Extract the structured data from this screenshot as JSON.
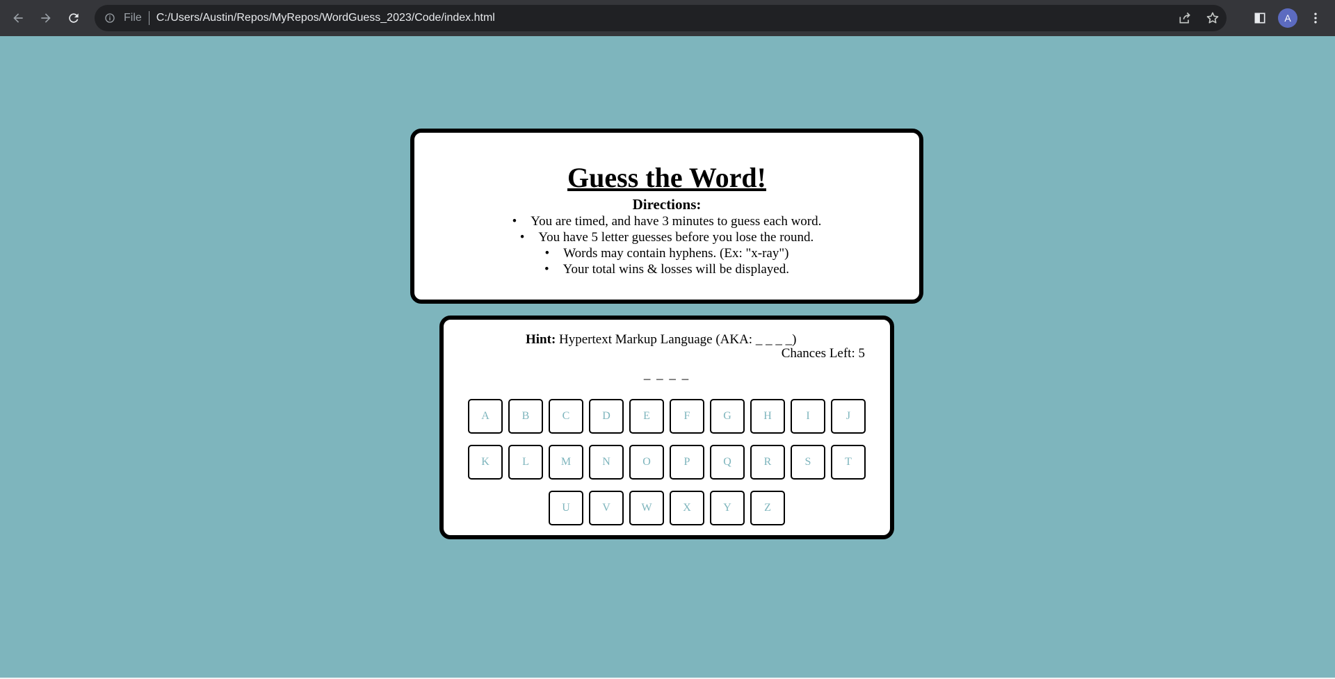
{
  "browser": {
    "scheme_label": "File",
    "url": "C:/Users/Austin/Repos/MyRepos/WordGuess_2023/Code/index.html",
    "avatar_letter": "A",
    "icons": [
      "back-arrow-icon",
      "forward-arrow-icon",
      "reload-icon",
      "info-icon",
      "share-icon",
      "star-icon",
      "side-panel-icon",
      "more-vert-icon"
    ]
  },
  "directions": {
    "title": "Guess the Word!",
    "subtitle": "Directions:",
    "rules": [
      "You are timed, and have 3 minutes to guess each word.",
      "You have 5 letter guesses before you lose the round.",
      "Words may contain hyphens. (Ex: \"x-ray\")",
      "Your total wins & losses will be displayed."
    ]
  },
  "game": {
    "hint_label": "Hint:",
    "hint_text": "Hypertext Markup Language (AKA: _ _ _ _)",
    "chances_text": "Chances Left: 5",
    "word_display": "_ _ _ _",
    "keyboard_rows": [
      [
        "A",
        "B",
        "C",
        "D",
        "E",
        "F",
        "G",
        "H",
        "I",
        "J"
      ],
      [
        "K",
        "L",
        "M",
        "N",
        "O",
        "P",
        "Q",
        "R",
        "S",
        "T"
      ],
      [
        "U",
        "V",
        "W",
        "X",
        "Y",
        "Z"
      ]
    ]
  },
  "colors": {
    "background": "#7eb5bd",
    "key_text": "#7eb5bd",
    "card_border": "#000000"
  }
}
